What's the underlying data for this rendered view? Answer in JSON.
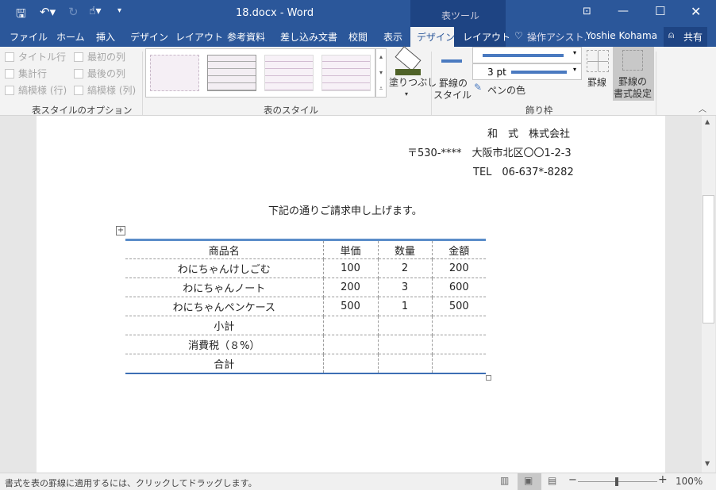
{
  "window": {
    "title": "18.docx - Word",
    "context_tab_group": "表ツール"
  },
  "tabs": [
    "ファイル",
    "ホーム",
    "挿入",
    "デザイン",
    "レイアウト",
    "参考資料",
    "差し込み文書",
    "校閲",
    "表示",
    "デザイン",
    "レイアウト"
  ],
  "tell_me": "操作アシスト.",
  "user": "Yoshie Kohama",
  "share": "共有",
  "ribbon": {
    "options": [
      "タイトル行",
      "最初の列",
      "集計行",
      "最後の列",
      "縞模様 (行)",
      "縞模様 (列)"
    ],
    "options_group": "表スタイルのオプション",
    "styles_group": "表のスタイル",
    "shading": "塗りつぶし",
    "border_style": [
      "罫線の",
      "スタイル"
    ],
    "pen_weight": "3 pt",
    "pen_color": "ペンの色",
    "borders": "罫線",
    "border_painter": [
      "罫線の",
      "書式設定"
    ],
    "borders_group": "飾り枠"
  },
  "document": {
    "company": "和　式　株式会社",
    "address": "〒530-****　大阪市北区〇〇1-2-3",
    "tel": "TEL　06-637*-8282",
    "intro": "下記の通りご請求申し上げます。",
    "headers": [
      "商品名",
      "単価",
      "数量",
      "金額"
    ],
    "rows": [
      [
        "わにちゃんけしごむ",
        "100",
        "2",
        "200"
      ],
      [
        "わにちゃんノート",
        "200",
        "3",
        "600"
      ],
      [
        "わにちゃんペンケース",
        "500",
        "1",
        "500"
      ],
      [
        "小計",
        "",
        "",
        ""
      ],
      [
        "消費税（８%）",
        "",
        "",
        ""
      ],
      [
        "合計",
        "",
        "",
        ""
      ]
    ]
  },
  "status": {
    "message": "書式を表の罫線に適用するには、クリックしてドラッグします。",
    "zoom": "100%",
    "zoom_level": 100
  }
}
